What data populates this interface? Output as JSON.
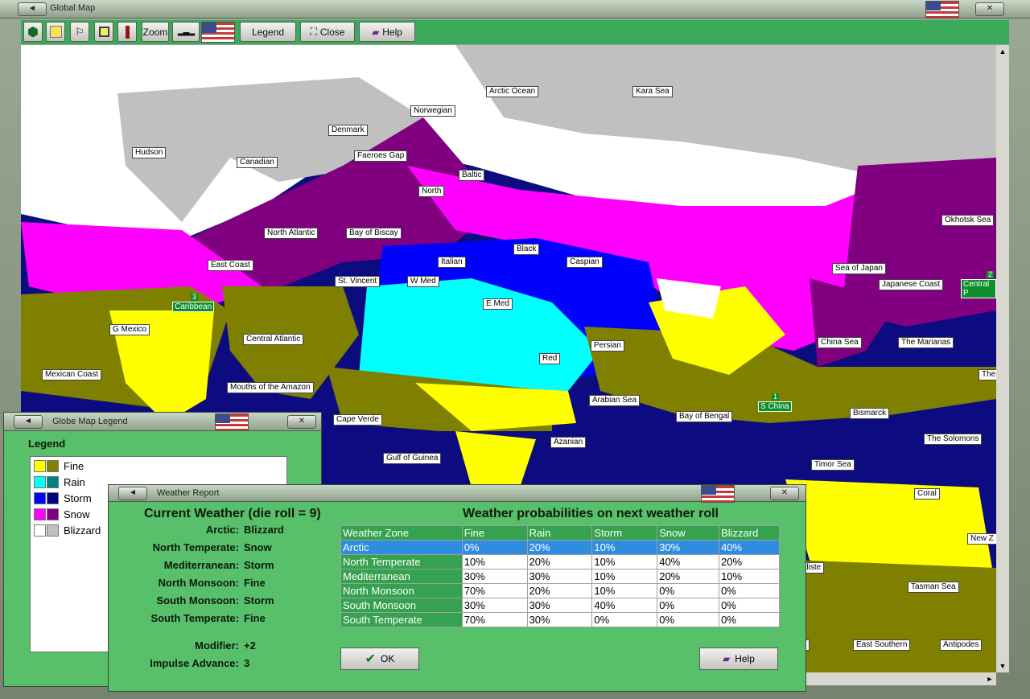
{
  "main_window": {
    "title": "Global Map",
    "toolbar": {
      "zoom_label": "Zoom",
      "legend_label": "Legend",
      "close_label": "Close",
      "help_label": "Help"
    }
  },
  "map": {
    "sea_labels": [
      "Arctic Ocean",
      "Kara Sea",
      "Norwegian",
      "Denmark",
      "Hudson",
      "Canadian",
      "Faeroes Gap",
      "Baltic",
      "North",
      "North Atlantic",
      "Bay of Biscay",
      "East Coast",
      "Black",
      "Italian",
      "Caspian",
      "St. Vincent",
      "W Med",
      "E Med",
      "G Mexico",
      "Central Atlantic",
      "Persian",
      "Red",
      "Mexican Coast",
      "Mouths of the Amazon",
      "Arabian Sea",
      "Cape Verde",
      "Bay of Bengal",
      "Azanian",
      "Gulf of Guinea",
      "Okhotsk Sea",
      "Sea of Japan",
      "Japanese Coast",
      "China Sea",
      "The Marianas",
      "Bismarck",
      "The Solomons",
      "Timor Sea",
      "Coral",
      "New Z",
      "Tasman Sea",
      "East Southern",
      "Antipodes",
      "The",
      "uraliste",
      "ern"
    ],
    "task_forces": [
      {
        "label": "Caribbean",
        "count": "3"
      },
      {
        "label": "S China",
        "count": "1"
      },
      {
        "label": "Central P",
        "count": "2"
      }
    ]
  },
  "legend_window": {
    "title": "Globe Map Legend",
    "heading": "Legend",
    "items": [
      {
        "label": "Fine",
        "c1": "#ffff00",
        "c2": "#808000"
      },
      {
        "label": "Rain",
        "c1": "#00ffff",
        "c2": "#008080"
      },
      {
        "label": "Storm",
        "c1": "#0000ff",
        "c2": "#000080"
      },
      {
        "label": "Snow",
        "c1": "#ff00ff",
        "c2": "#800080"
      },
      {
        "label": "Blizzard",
        "c1": "#ffffff",
        "c2": "#c0c0c0"
      }
    ]
  },
  "weather_report": {
    "title": "Weather Report",
    "current_heading": "Current Weather (die roll = 9)",
    "prob_heading": "Weather probabilities on next weather roll",
    "current": [
      {
        "zone": "Arctic:",
        "value": "Blizzard"
      },
      {
        "zone": "North Temperate:",
        "value": "Snow"
      },
      {
        "zone": "Mediterranean:",
        "value": "Storm"
      },
      {
        "zone": "North Monsoon:",
        "value": "Fine"
      },
      {
        "zone": "South Monsoon:",
        "value": "Storm"
      },
      {
        "zone": "South Temperate:",
        "value": "Fine"
      }
    ],
    "modifier_label": "Modifier:",
    "modifier_value": "+2",
    "impulse_label": "Impulse Advance:",
    "impulse_value": "3",
    "table_headers": [
      "Weather Zone",
      "Fine",
      "Rain",
      "Storm",
      "Snow",
      "Blizzard"
    ],
    "table_rows": [
      [
        "Arctic",
        "0%",
        "20%",
        "10%",
        "30%",
        "40%"
      ],
      [
        "North Temperate",
        "10%",
        "20%",
        "10%",
        "40%",
        "20%"
      ],
      [
        "Mediterranean",
        "30%",
        "30%",
        "10%",
        "20%",
        "10%"
      ],
      [
        "North Monsoon",
        "70%",
        "20%",
        "10%",
        "0%",
        "0%"
      ],
      [
        "South Monsoon",
        "30%",
        "30%",
        "40%",
        "0%",
        "0%"
      ],
      [
        "South Temperate",
        "70%",
        "30%",
        "0%",
        "0%",
        "0%"
      ]
    ],
    "ok_label": "OK",
    "help_label": "Help"
  }
}
